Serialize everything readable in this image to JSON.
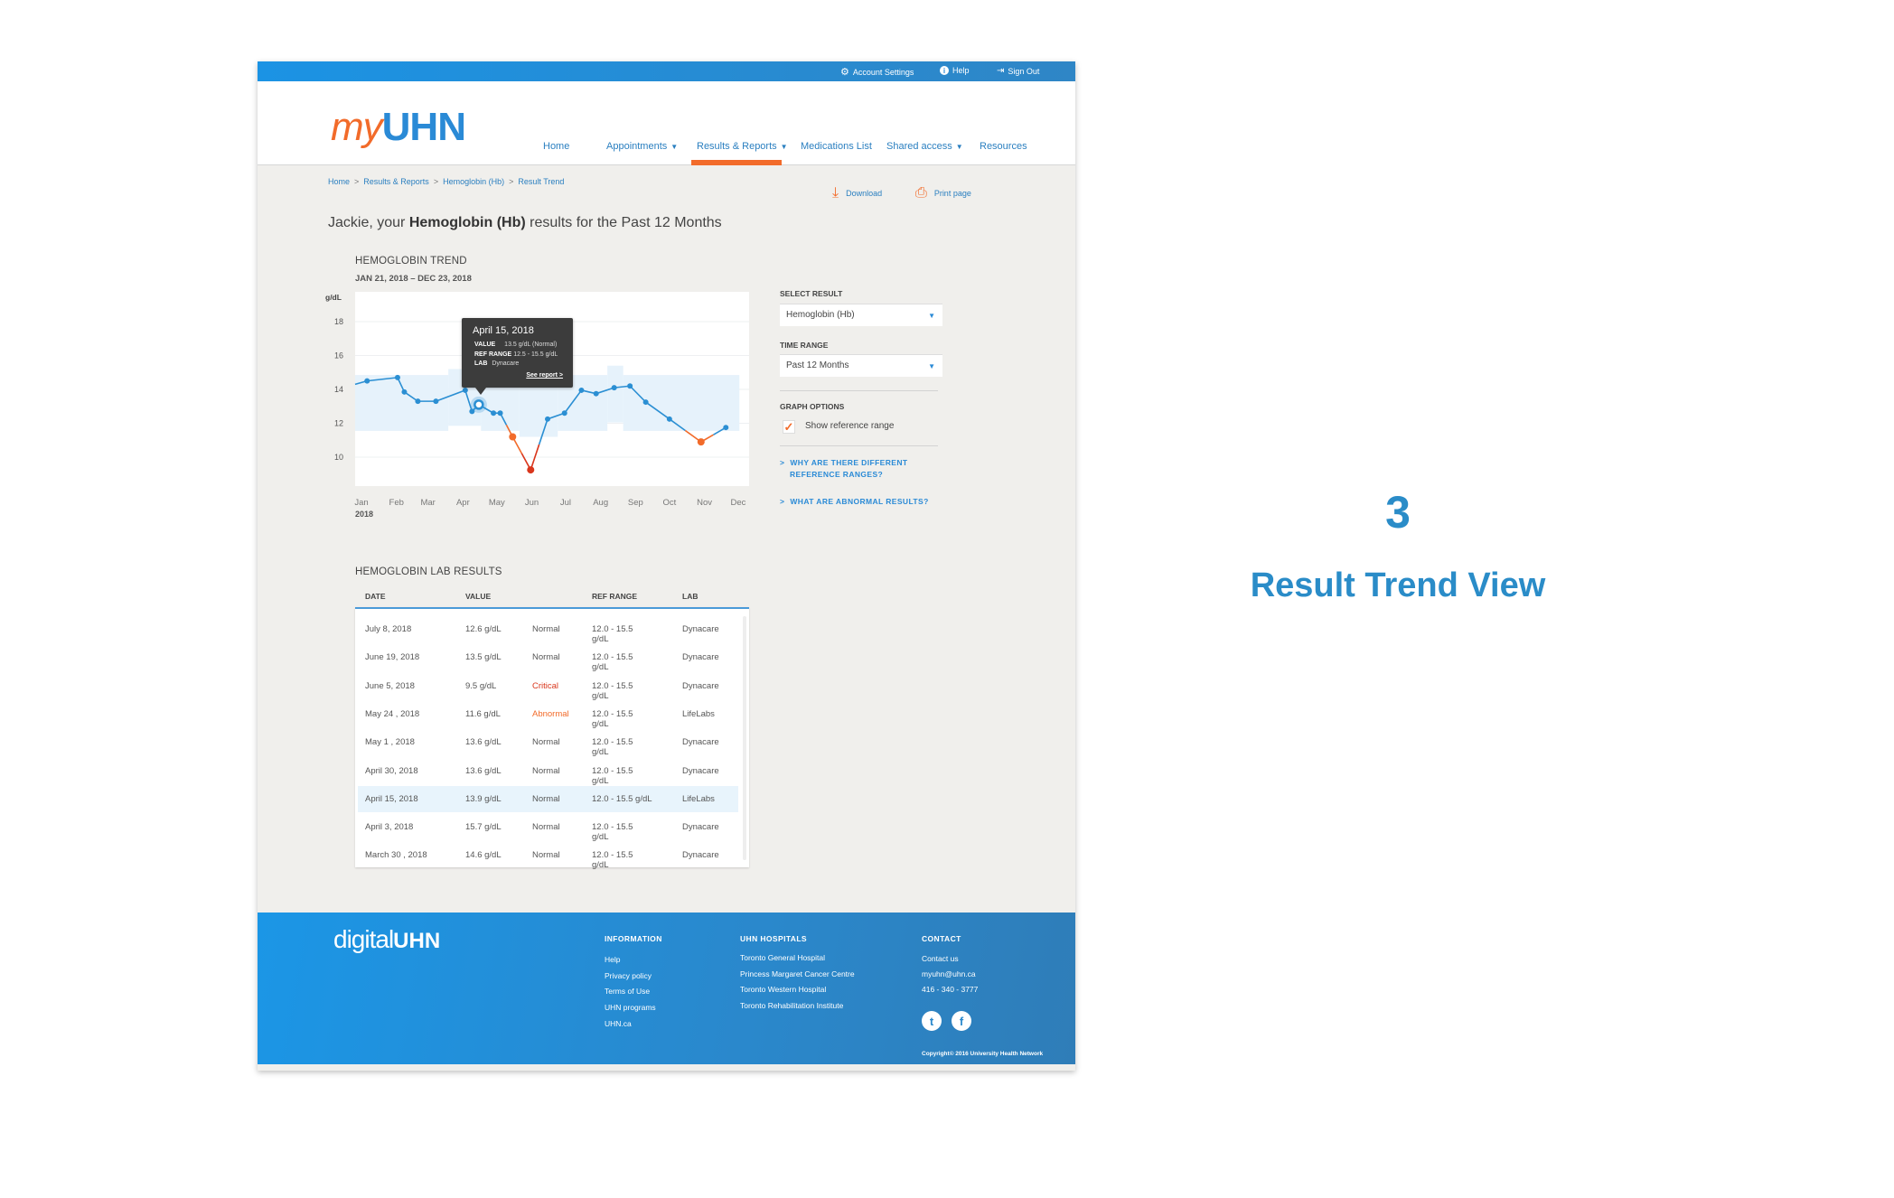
{
  "topbar": {
    "items": [
      {
        "label": "Account Settings",
        "icon": "gear-icon"
      },
      {
        "label": "Help",
        "icon": "info-icon"
      },
      {
        "label": "Sign Out",
        "icon": "sign-out-icon"
      }
    ]
  },
  "header": {
    "logo": {
      "my": "my",
      "uhn": "UHN"
    },
    "nav": [
      {
        "label": "Home",
        "dropdown": false
      },
      {
        "label": "Appointments",
        "dropdown": true
      },
      {
        "label": "Results & Reports",
        "dropdown": true,
        "active": true
      },
      {
        "label": "Medications List",
        "dropdown": false
      },
      {
        "label": "Shared access",
        "dropdown": true
      },
      {
        "label": "Resources",
        "dropdown": false
      }
    ],
    "caret": "▼"
  },
  "breadcrumb": [
    "Home",
    "Results & Reports",
    "Hemoglobin (Hb)",
    "Result Trend"
  ],
  "breadcrumb_sep": ">",
  "actions": {
    "download": "Download",
    "print": "Print page"
  },
  "page_title": {
    "prefix": "Jackie, your ",
    "bold": "Hemoglobin (Hb)",
    "suffix": " results for the Past 12 Months"
  },
  "trend": {
    "heading": "HEMOGLOBIN TREND",
    "date_range": "JAN 21, 2018 – DEC 23, 2018"
  },
  "tooltip": {
    "date": "April 15, 2018",
    "value_label": "VALUE",
    "value": "13.5 g/dL (Normal)",
    "ref_label": "REF RANGE",
    "ref": "12.5 - 15.5 g/dL",
    "lab_label": "LAB",
    "lab": "Dynacare",
    "link": "See report >"
  },
  "chart_data": {
    "type": "line",
    "ylabel": "g/dL",
    "year_label": "2018",
    "ylim": [
      8.3,
      19.8
    ],
    "yticks": [
      10,
      12,
      14,
      16,
      18
    ],
    "xlim": [
      "2017-12-26",
      "2018-12-10"
    ],
    "xticks": [
      {
        "date": "2018-01-01",
        "label": "Jan"
      },
      {
        "date": "2018-02-01",
        "label": "Feb"
      },
      {
        "date": "2018-03-01",
        "label": "Mar"
      },
      {
        "date": "2018-04-01",
        "label": "Apr"
      },
      {
        "date": "2018-05-01",
        "label": "May"
      },
      {
        "date": "2018-06-01",
        "label": "Jun"
      },
      {
        "date": "2018-07-01",
        "label": "Jul"
      },
      {
        "date": "2018-08-01",
        "label": "Aug"
      },
      {
        "date": "2018-09-01",
        "label": "Sep"
      },
      {
        "date": "2018-10-01",
        "label": "Oct"
      },
      {
        "date": "2018-11-01",
        "label": "Nov"
      },
      {
        "date": "2018-12-01",
        "label": "Dec"
      }
    ],
    "grid": true,
    "reference_range_bands": [
      {
        "from": "2017-12-26",
        "to": "2018-03-19",
        "low": 11.55,
        "high": 14.85
      },
      {
        "from": "2018-03-19",
        "to": "2018-04-17",
        "low": 11.85,
        "high": 15.2
      },
      {
        "from": "2018-04-17",
        "to": "2018-05-21",
        "low": 11.55,
        "high": 14.85
      },
      {
        "from": "2018-05-21",
        "to": "2018-06-24",
        "low": 11.2,
        "high": 14.85
      },
      {
        "from": "2018-06-24",
        "to": "2018-08-07",
        "low": 11.55,
        "high": 14.85
      },
      {
        "from": "2018-08-07",
        "to": "2018-08-21",
        "low": 12.05,
        "high": 15.4
      },
      {
        "from": "2018-08-21",
        "to": "2018-12-02",
        "low": 11.55,
        "high": 14.85
      }
    ],
    "points": [
      {
        "date": "2017-12-26",
        "value": 14.3,
        "status": "normal",
        "marker": false
      },
      {
        "date": "2018-01-06",
        "value": 14.5,
        "status": "normal"
      },
      {
        "date": "2018-02-02",
        "value": 14.7,
        "status": "normal"
      },
      {
        "date": "2018-02-08",
        "value": 13.85,
        "status": "normal"
      },
      {
        "date": "2018-02-20",
        "value": 13.3,
        "status": "normal"
      },
      {
        "date": "2018-03-08",
        "value": 13.3,
        "status": "normal"
      },
      {
        "date": "2018-04-03",
        "value": 13.95,
        "status": "normal"
      },
      {
        "date": "2018-04-09",
        "value": 12.7,
        "status": "normal"
      },
      {
        "date": "2018-04-15",
        "value": 13.1,
        "status": "normal",
        "selected": true
      },
      {
        "date": "2018-04-28",
        "value": 12.6,
        "status": "normal"
      },
      {
        "date": "2018-05-04",
        "value": 12.6,
        "status": "normal"
      },
      {
        "date": "2018-05-15",
        "value": 11.2,
        "status": "abnormal"
      },
      {
        "date": "2018-05-31",
        "value": 9.25,
        "status": "critical"
      },
      {
        "date": "2018-06-15",
        "value": 12.25,
        "status": "normal"
      },
      {
        "date": "2018-06-30",
        "value": 12.6,
        "status": "normal"
      },
      {
        "date": "2018-07-15",
        "value": 13.95,
        "status": "normal"
      },
      {
        "date": "2018-07-28",
        "value": 13.75,
        "status": "normal"
      },
      {
        "date": "2018-08-13",
        "value": 14.1,
        "status": "normal"
      },
      {
        "date": "2018-08-27",
        "value": 14.2,
        "status": "normal"
      },
      {
        "date": "2018-09-10",
        "value": 13.25,
        "status": "normal"
      },
      {
        "date": "2018-10-01",
        "value": 12.25,
        "status": "normal"
      },
      {
        "date": "2018-10-29",
        "value": 10.9,
        "status": "abnormal"
      },
      {
        "date": "2018-11-20",
        "value": 11.75,
        "status": "normal"
      }
    ],
    "colors": {
      "normal": "#2b8fd3",
      "abnormal": "#f26b2a",
      "critical": "#d9361c",
      "band": "#e6f2fb",
      "grid": "#eef0f2"
    }
  },
  "panel": {
    "select_result_label": "SELECT RESULT",
    "select_result_value": "Hemoglobin (Hb)",
    "time_range_label": "TIME RANGE",
    "time_range_value": "Past 12 Months",
    "graph_options_label": "GRAPH OPTIONS",
    "show_ref_label": "Show reference range",
    "show_ref_checked": true,
    "link1_line1": "WHY ARE THERE DIFFERENT",
    "link1_line2": "REFERENCE RANGES?",
    "link2": "WHAT ARE ABNORMAL RESULTS?"
  },
  "results": {
    "heading": "HEMOGLOBIN LAB RESULTS",
    "columns": [
      "DATE",
      "VALUE",
      "REF RANGE",
      "LAB"
    ],
    "rows": [
      {
        "date": "July 8, 2018",
        "value": "12.6 g/dL",
        "status": "Normal",
        "ref": "12.0 - 15.5 g/dL",
        "lab": "Dynacare"
      },
      {
        "date": "June 19, 2018",
        "value": "13.5 g/dL",
        "status": "Normal",
        "ref": "12.0 - 15.5 g/dL",
        "lab": "Dynacare"
      },
      {
        "date": "June 5, 2018",
        "value": "9.5 g/dL",
        "status": "Critical",
        "ref": "12.0 - 15.5 g/dL",
        "lab": "Dynacare"
      },
      {
        "date": "May 24 , 2018",
        "value": "11.6 g/dL",
        "status": "Abnormal",
        "ref": "12.0 - 15.5 g/dL",
        "lab": "LifeLabs"
      },
      {
        "date": "May 1 , 2018",
        "value": "13.6 g/dL",
        "status": "Normal",
        "ref": "12.0 - 15.5 g/dL",
        "lab": "Dynacare"
      },
      {
        "date": "April 30, 2018",
        "value": "13.6 g/dL",
        "status": "Normal",
        "ref": "12.0 - 15.5 g/dL",
        "lab": "Dynacare"
      },
      {
        "date": "April 15, 2018",
        "value": "13.9 g/dL",
        "status": "Normal",
        "ref": "12.0 - 15.5 g/dL",
        "lab": "LifeLabs",
        "highlighted": true
      },
      {
        "date": "April 3, 2018",
        "value": "15.7 g/dL",
        "status": "Normal",
        "ref": "12.0 - 15.5 g/dL",
        "lab": "Dynacare"
      },
      {
        "date": "March 30 , 2018",
        "value": "14.6 g/dL",
        "status": "Normal",
        "ref": "12.0 - 15.5 g/dL",
        "lab": "Dynacare"
      }
    ]
  },
  "footer": {
    "logo": {
      "digital": "digital",
      "uhn": "UHN"
    },
    "information": {
      "heading": "INFORMATION",
      "items": [
        "Help",
        "Privacy policy",
        "Terms of Use",
        "UHN programs",
        "UHN.ca"
      ]
    },
    "hospitals": {
      "heading": "UHN HOSPITALS",
      "items": [
        "Toronto General Hospital",
        "Princess Margaret Cancer Centre",
        "Toronto Western Hospital",
        "Toronto Rehabilitation Institute"
      ]
    },
    "contact": {
      "heading": "CONTACT",
      "items": [
        "Contact us",
        "myuhn@uhn.ca",
        "416 - 340 - 3777"
      ]
    },
    "social": [
      "twitter-icon",
      "facebook-icon"
    ],
    "copyright": "Copyright© 2016 University Health Network"
  },
  "annotation": {
    "number": "3",
    "title": "Result Trend View"
  }
}
